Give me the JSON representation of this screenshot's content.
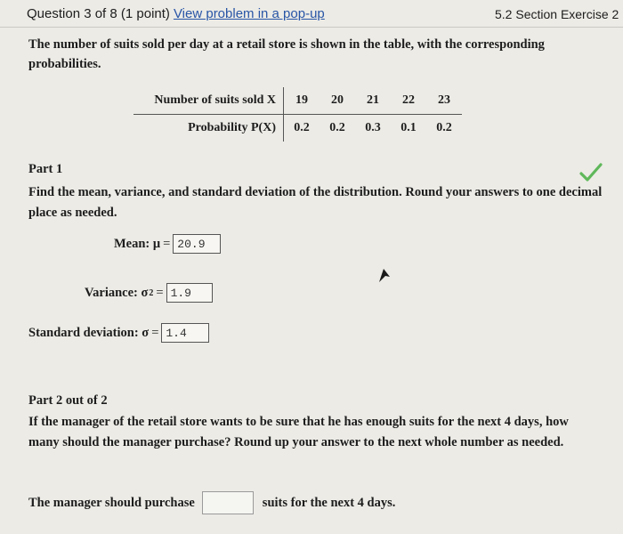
{
  "header": {
    "question_label": "Question 3 of 8 (1 point)",
    "view_link": "View problem in a pop-up",
    "section": "5.2 Section Exercise 2"
  },
  "problem": {
    "intro": "The number of suits sold per day at a retail store is shown in the table, with the corresponding probabilities."
  },
  "table": {
    "row1_label": "Number of suits sold X",
    "row2_label": "Probability P(X)",
    "x_values": [
      "19",
      "20",
      "21",
      "22",
      "23"
    ],
    "p_values": [
      "0.2",
      "0.2",
      "0.3",
      "0.1",
      "0.2"
    ]
  },
  "part1": {
    "title": "Part 1",
    "instructions": "Find the mean, variance, and standard deviation of the distribution. Round your answers to one decimal place as needed.",
    "mean_label": "Mean: μ",
    "mean_value": "20.9",
    "variance_label": "Variance: σ",
    "variance_value": "1.9",
    "sd_label": "Standard deviation: σ",
    "sd_value": "1.4",
    "status": "correct"
  },
  "part2": {
    "title": "Part 2 out of 2",
    "question": "If the manager of the retail store wants to be sure that he has enough suits for the next 4 days, how many should the manager purchase? Round up your answer to the next whole number as needed.",
    "answer_prefix": "The manager should purchase",
    "answer_value": "",
    "answer_suffix": "suits for the next 4 days."
  },
  "colors": {
    "background": "#ecebe6",
    "link": "#2855a6",
    "check": "#5fb85a"
  }
}
